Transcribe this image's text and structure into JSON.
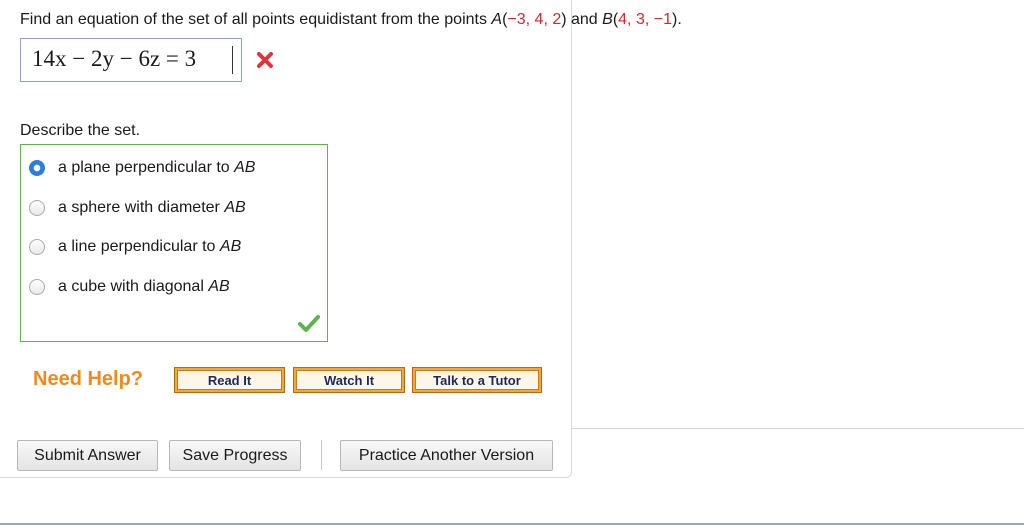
{
  "question": {
    "prefix": "Find an equation of the set of all points equidistant from the points ",
    "point_a_label": "A",
    "point_a_coords": "−3, 4, 2",
    "and_text": " and ",
    "point_b_label": "B",
    "point_b_coords": "4, 3, −1",
    "open_paren": "(",
    "close_paren": ")",
    "end_period": ".",
    "coord_color": "#d9262a"
  },
  "answer": {
    "value": "14x − 2y − 6z = 3",
    "status": "incorrect",
    "status_icon": "x-mark-icon"
  },
  "describe": {
    "label": "Describe the set.",
    "options": [
      {
        "text": "a plane perpendicular to ",
        "var": "AB",
        "selected": true
      },
      {
        "text": "a sphere with diameter ",
        "var": "AB",
        "selected": false
      },
      {
        "text": "a line perpendicular to ",
        "var": "AB",
        "selected": false
      },
      {
        "text": "a cube with diagonal ",
        "var": "AB",
        "selected": false
      }
    ],
    "status": "correct",
    "status_icon": "check-mark-icon"
  },
  "help": {
    "label": "Need Help?",
    "buttons": [
      "Read It",
      "Watch It",
      "Talk to a Tutor"
    ]
  },
  "actions": {
    "submit": "Submit Answer",
    "save": "Save Progress",
    "practice": "Practice Another Version"
  }
}
